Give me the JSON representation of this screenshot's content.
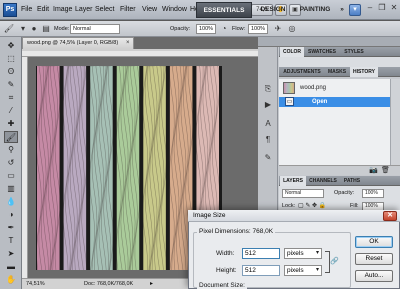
{
  "app": {
    "logo": "Ps"
  },
  "menubar": {
    "items": [
      "File",
      "Edit",
      "Image",
      "Layer",
      "Select",
      "Filter",
      "View",
      "Window",
      "Help"
    ],
    "zoom_value": "74,5",
    "workspaces": [
      "ESSENTIALS",
      "DESIGN",
      "PAINTING",
      "»"
    ]
  },
  "options": {
    "mode_label": "Mode:",
    "mode_value": "Normal",
    "opacity_label": "Opacity:",
    "opacity_value": "100%",
    "flow_label": "Flow:",
    "flow_value": "100%"
  },
  "document": {
    "tab_title": "wood.png @ 74,5% (Layer 0, RGB/8)",
    "zoom": "74,51%",
    "status": "Doc: 768,0K/768,0K",
    "stripe_colors": [
      "#c58aa5",
      "#b9a9c0",
      "#a6c0b5",
      "#aacb9a",
      "#c8c98a",
      "#d6ab8c",
      "#dcb9b4"
    ]
  },
  "panels": {
    "color_tabs": [
      "COLOR",
      "SWATCHES",
      "STYLES"
    ],
    "history_tabs": [
      "ADJUSTMENTS",
      "MASKS",
      "HISTORY"
    ],
    "history_snapshot": "wood.png",
    "history_state": "Open",
    "layers_tabs": [
      "LAYERS",
      "CHANNELS",
      "PATHS"
    ],
    "layers_mode": "Normal",
    "opacity_label": "Opacity:",
    "opacity_value": "100%",
    "lock_label": "Lock:",
    "fill_label": "Fill:",
    "fill_value": "100%"
  },
  "dialog": {
    "title": "Image Size",
    "pixel_dimensions": "Pixel Dimensions: 768,0K",
    "width_label": "Width:",
    "width_value": "512",
    "width_unit": "pixels",
    "height_label": "Height:",
    "height_value": "512",
    "height_unit": "pixels",
    "doc_size_label": "Document Size:",
    "ok": "OK",
    "reset": "Reset",
    "auto": "Auto..."
  },
  "colors": {
    "accent": "#3a8ee6",
    "dialog_bg": "#e9ebee"
  }
}
